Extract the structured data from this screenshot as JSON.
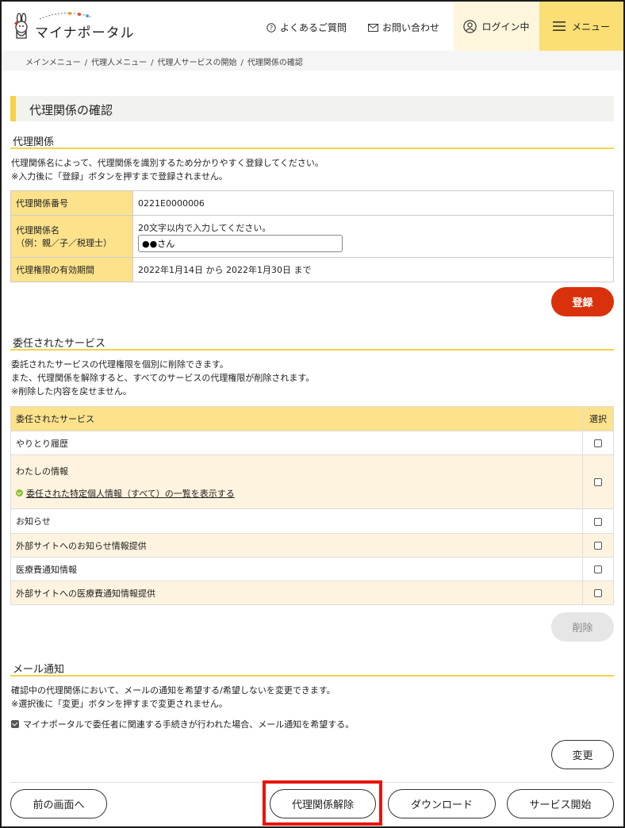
{
  "header": {
    "logo_text": "マイナポータル",
    "faq": "よくあるご質問",
    "contact": "お問い合わせ",
    "login": "ログイン中",
    "menu": "メニュー"
  },
  "breadcrumb": [
    "メインメニュー",
    "代理人メニュー",
    "代理人サービスの開始",
    "代理関係の確認"
  ],
  "page_title": "代理関係の確認",
  "relation_section": {
    "heading": "代理関係",
    "desc1": "代理関係名によって、代理関係を識別するため分かりやすく登録してください。",
    "desc2": "※入力後に「登録」ボタンを押すまで登録されません。",
    "number_label": "代理関係番号",
    "number_value": "0221E0000006",
    "name_label1": "代理関係名",
    "name_label2": "（例：親／子／税理士）",
    "name_hint": "20文字以内で入力してください。",
    "name_value": "●●さん",
    "period_label": "代理権限の有効期間",
    "period_value": "2022年1月14日 から 2022年1月30日 まで",
    "register_button": "登録"
  },
  "services_section": {
    "heading": "委任されたサービス",
    "desc1": "委託されたサービスの代理権限を個別に削除できます。",
    "desc2": "また、代理関係を解除すると、すべてのサービスの代理権限が削除されます。",
    "desc3": "※削除した内容を戻せません。",
    "col_service": "委任されたサービス",
    "col_select": "選択",
    "rows": [
      "やりとり履歴",
      "わたしの情報",
      "お知らせ",
      "外部サイトへのお知らせ情報提供",
      "医療費通知情報",
      "外部サイトへの医療費通知情報提供"
    ],
    "info_link": "委任された特定個人情報（すべて）の一覧を表示する",
    "delete_button": "削除"
  },
  "mail_section": {
    "heading": "メール通知",
    "desc1": "確認中の代理関係において、メールの通知を希望する/希望しないを変更できます。",
    "desc2": "※選択後に「変更」ボタンを押すまで変更されません。",
    "checkbox_label": "マイナポータルで委任者に関連する手続きが行われた場合、メール通知を希望する。",
    "change_button": "変更"
  },
  "footer": {
    "back": "前の画面へ",
    "release": "代理関係解除",
    "download": "ダウンロード",
    "start": "サービス開始"
  }
}
